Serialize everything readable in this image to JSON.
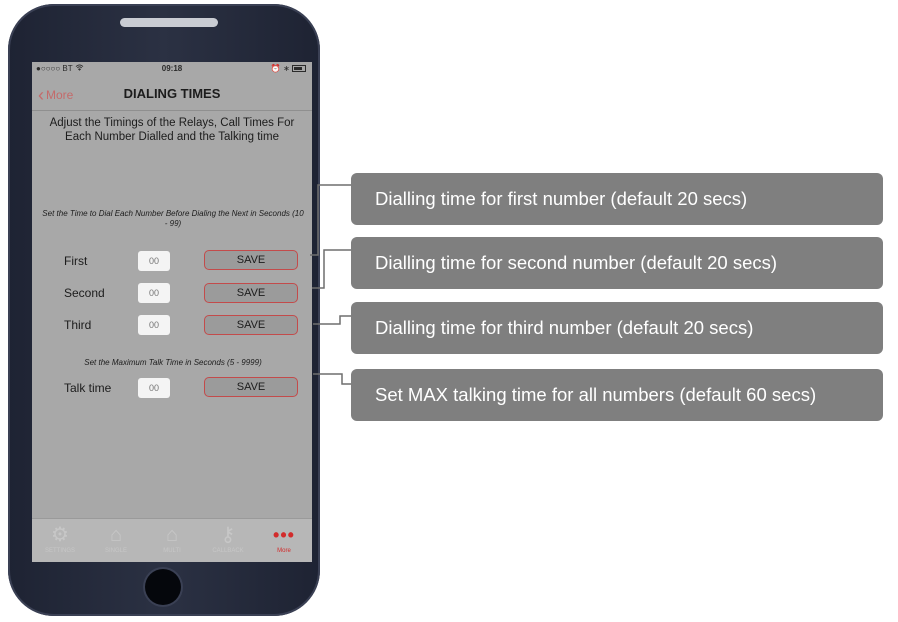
{
  "status_bar": {
    "carrier": "●○○○○ BT",
    "wifi_icon": "wifi-icon",
    "time": "09:18"
  },
  "nav": {
    "back_label": "More",
    "title": "DIALING TIMES"
  },
  "description": "Adjust the Timings of the Relays, Call Times For Each Number Dialled and the Talking time",
  "dial_hint": "Set the Time to Dial Each Number Before Dialing the Next in Seconds (10 - 99)",
  "talk_hint": "Set the Maximum Talk Time in Seconds (5 - 9999)",
  "rows": [
    {
      "label": "First",
      "placeholder": "00",
      "button": "SAVE"
    },
    {
      "label": "Second",
      "placeholder": "00",
      "button": "SAVE"
    },
    {
      "label": "Third",
      "placeholder": "00",
      "button": "SAVE"
    },
    {
      "label": "Talk time",
      "placeholder": "00",
      "button": "SAVE"
    }
  ],
  "tabs": [
    {
      "label": "SETTINGS",
      "icon": "gear-icon"
    },
    {
      "label": "SINGLE",
      "icon": "house-icon"
    },
    {
      "label": "MULTI",
      "icon": "multi-house-icon"
    },
    {
      "label": "CALLBACK",
      "icon": "key-icon"
    },
    {
      "label": "More",
      "icon": "more-dots-icon",
      "active": true
    }
  ],
  "callouts": [
    "Dialling time for first number (default 20 secs)",
    "Dialling time for second number (default 20 secs)",
    "Dialling time for third number (default 20 secs)",
    "Set MAX talking time for all numbers (default 60 secs)"
  ],
  "colors": {
    "callout_bg": "#7f7f7f",
    "accent_red": "#c34b4b",
    "screen_bg": "#a8a8a8",
    "phone_body": "#2b3143"
  }
}
